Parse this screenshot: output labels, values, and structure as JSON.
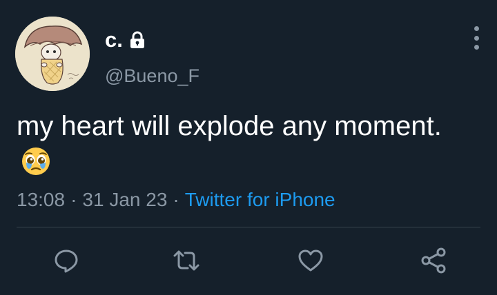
{
  "tweet": {
    "display_name": "c.",
    "handle": "@Bueno_F",
    "text": "my heart will explode any moment.",
    "emoji": "pleading-face-with-tears",
    "time": "13:08",
    "date": "31 Jan 23",
    "separator": "·",
    "source": "Twitter for iPhone",
    "protected_icon": "lock-icon"
  },
  "actions": [
    {
      "name": "reply",
      "icon": "speech-bubble-icon"
    },
    {
      "name": "retweet",
      "icon": "retweet-icon"
    },
    {
      "name": "like",
      "icon": "heart-icon"
    },
    {
      "name": "share",
      "icon": "share-icon"
    }
  ],
  "colors": {
    "background": "#15202b",
    "text": "#ffffff",
    "secondary_text": "#8b98a5",
    "link": "#1d9bf0",
    "divider": "#38444d"
  }
}
